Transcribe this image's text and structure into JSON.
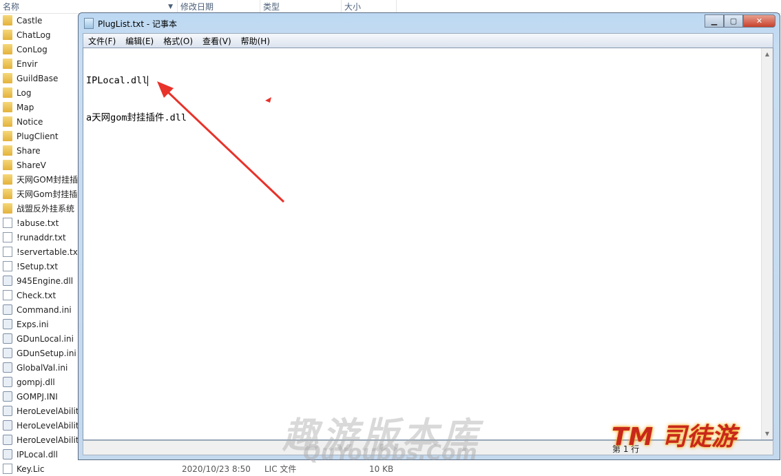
{
  "explorer": {
    "columns": [
      "名称",
      "修改日期",
      "类型",
      "大小"
    ],
    "items": [
      {
        "name": "Castle",
        "kind": "folder"
      },
      {
        "name": "ChatLog",
        "kind": "folder"
      },
      {
        "name": "ConLog",
        "kind": "folder"
      },
      {
        "name": "Envir",
        "kind": "folder"
      },
      {
        "name": "GuildBase",
        "kind": "folder"
      },
      {
        "name": "Log",
        "kind": "folder"
      },
      {
        "name": "Map",
        "kind": "folder"
      },
      {
        "name": "Notice",
        "kind": "folder"
      },
      {
        "name": "PlugClient",
        "kind": "folder"
      },
      {
        "name": "Share",
        "kind": "folder"
      },
      {
        "name": "ShareV",
        "kind": "folder"
      },
      {
        "name": "天网GOM封挂插件",
        "kind": "folder"
      },
      {
        "name": "天网Gom封挂插件",
        "kind": "folder"
      },
      {
        "name": "战盟反外挂系统",
        "kind": "folder"
      },
      {
        "name": "!abuse.txt",
        "kind": "file"
      },
      {
        "name": "!runaddr.txt",
        "kind": "file"
      },
      {
        "name": "!servertable.txt",
        "kind": "file"
      },
      {
        "name": "!Setup.txt",
        "kind": "file"
      },
      {
        "name": "945Engine.dll",
        "kind": "cfg"
      },
      {
        "name": "Check.txt",
        "kind": "file"
      },
      {
        "name": "Command.ini",
        "kind": "cfg"
      },
      {
        "name": "Exps.ini",
        "kind": "cfg"
      },
      {
        "name": "GDunLocal.ini",
        "kind": "cfg"
      },
      {
        "name": "GDunSetup.ini",
        "kind": "cfg"
      },
      {
        "name": "GlobalVal.ini",
        "kind": "cfg"
      },
      {
        "name": "gompj.dll",
        "kind": "cfg"
      },
      {
        "name": "GOMPJ.INI",
        "kind": "cfg"
      },
      {
        "name": "HeroLevelAbility",
        "kind": "cfg"
      },
      {
        "name": "HeroLevelAbility",
        "kind": "cfg"
      },
      {
        "name": "HeroLevelAbility",
        "kind": "cfg"
      },
      {
        "name": "IPLocal.dll",
        "kind": "cfg"
      }
    ],
    "last_row": {
      "name": "Key.Lic",
      "date": "2020/10/23 8:50",
      "type": "LIC 文件",
      "size": "10 KB"
    }
  },
  "notepad": {
    "title": "PlugList.txt - 记事本",
    "menu": [
      "文件(F)",
      "编辑(E)",
      "格式(O)",
      "查看(V)",
      "帮助(H)"
    ],
    "lines": [
      "IPLocal.dll",
      "a天网gom封挂插件.dll"
    ],
    "status": "第 1 行"
  },
  "annotation_color": "#e8322a",
  "watermarks": {
    "site": "趣游版本库",
    "url": "QuYoubbs.Com",
    "logo": "TM 司徒游"
  }
}
